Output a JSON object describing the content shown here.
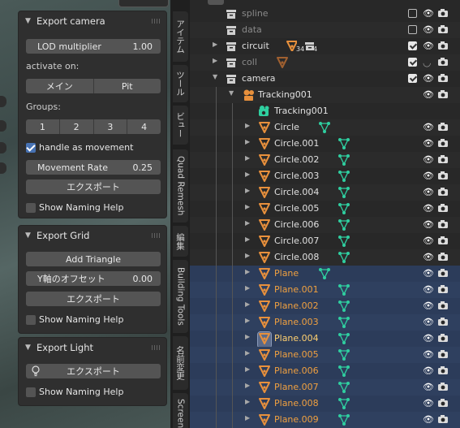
{
  "export_camera": {
    "title": "Export camera",
    "lod_label": "LOD multiplier",
    "lod_value": "1.00",
    "activate_label": "activate on:",
    "activate_options": [
      "メイン",
      "Pit"
    ],
    "groups_label": "Groups:",
    "groups": [
      "1",
      "2",
      "3",
      "4"
    ],
    "handle_label": "handle as movement",
    "movement_label": "Movement Rate",
    "movement_value": "0.25",
    "export_label": "エクスポート",
    "naming_help": "Show Naming Help"
  },
  "export_grid": {
    "title": "Export Grid",
    "add_triangle": "Add Triangle",
    "offset_label": "Y軸のオフセット",
    "offset_value": "0.00",
    "export_label": "エクスポート",
    "naming_help": "Show Naming Help"
  },
  "export_light": {
    "title": "Export Light",
    "export_label": "エクスポート",
    "naming_help": "Show Naming Help"
  },
  "sidebar_tabs": [
    "アイテム",
    "ツール",
    "ビュー",
    "Quad Remesh",
    "編集",
    "Building Tools",
    "名前変更",
    "Screen"
  ],
  "outliner": {
    "rows": [
      {
        "name": "spline",
        "kind": "collection",
        "dim": true
      },
      {
        "name": "data",
        "kind": "collection",
        "dim": true
      },
      {
        "name": "circuit",
        "kind": "collection",
        "badge1": "34",
        "badge2": "4"
      },
      {
        "name": "coll",
        "kind": "collection",
        "dim": true
      },
      {
        "name": "camera",
        "kind": "collection"
      },
      {
        "name": "Tracking001",
        "kind": "object"
      },
      {
        "name": "Tracking001",
        "kind": "camera-data"
      },
      {
        "name": "Circle",
        "kind": "mesh"
      },
      {
        "name": "Circle.001",
        "kind": "mesh"
      },
      {
        "name": "Circle.002",
        "kind": "mesh"
      },
      {
        "name": "Circle.003",
        "kind": "mesh"
      },
      {
        "name": "Circle.004",
        "kind": "mesh"
      },
      {
        "name": "Circle.005",
        "kind": "mesh"
      },
      {
        "name": "Circle.006",
        "kind": "mesh"
      },
      {
        "name": "Circle.007",
        "kind": "mesh"
      },
      {
        "name": "Circle.008",
        "kind": "mesh"
      },
      {
        "name": "Plane",
        "kind": "mesh",
        "selected": true
      },
      {
        "name": "Plane.001",
        "kind": "mesh",
        "selected": true
      },
      {
        "name": "Plane.002",
        "kind": "mesh",
        "selected": true
      },
      {
        "name": "Plane.003",
        "kind": "mesh",
        "selected": true
      },
      {
        "name": "Plane.004",
        "kind": "mesh",
        "selected": true,
        "active": true
      },
      {
        "name": "Plane.005",
        "kind": "mesh",
        "selected": true
      },
      {
        "name": "Plane.006",
        "kind": "mesh",
        "selected": true
      },
      {
        "name": "Plane.007",
        "kind": "mesh",
        "selected": true
      },
      {
        "name": "Plane.008",
        "kind": "mesh",
        "selected": true
      },
      {
        "name": "Plane.009",
        "kind": "mesh",
        "selected": true
      }
    ]
  },
  "colors": {
    "accent": "#4772b3",
    "selected_text": "#f0a040",
    "mesh_icon": "#e8903c",
    "vertex_icon": "#2fcfa0"
  }
}
